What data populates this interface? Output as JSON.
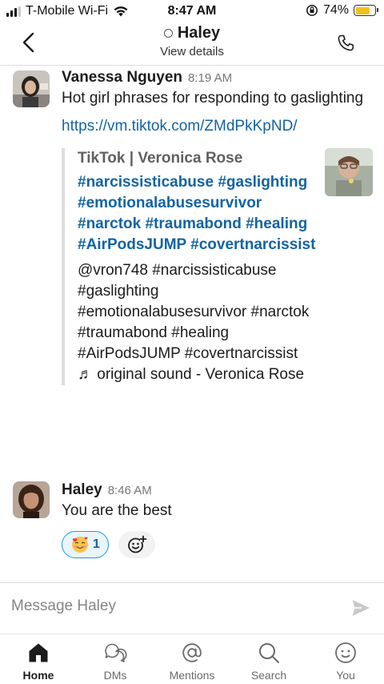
{
  "status_bar": {
    "carrier": "T-Mobile Wi-Fi",
    "time": "8:47 AM",
    "battery": "74%",
    "battery_level": 0.74,
    "battery_color": "#f3c21a"
  },
  "header": {
    "title": "Haley",
    "subtitle": "View details",
    "back_icon": "chevron-left-icon",
    "call_icon": "phone-icon"
  },
  "messages": [
    {
      "sender": "Vanessa Nguyen",
      "time": "8:19 AM",
      "text": "Hot girl phrases for responding to gaslighting",
      "link": "https://vm.tiktok.com/ZMdPkKpND/",
      "unfurl": {
        "source": "TikTok | Veronica Rose",
        "title": "#narcissisticabuse #gaslighting #emotionalabusesurvivor #narctok #traumabond #healing #AirPodsJUMP #covertnarcissist",
        "description": "@vron748 #narcissisticabuse #gaslighting #emotionalabusesurvivor #narctok #traumabond #healing #AirPodsJUMP #covertnarcissist ♬ original sound - Veronica Rose"
      }
    },
    {
      "sender": "Haley",
      "time": "8:46 AM",
      "text": "You are the best",
      "reactions": [
        {
          "emoji": "🥰",
          "count": "1",
          "icon": "smiling-face-with-hearts-icon"
        }
      ],
      "add_reaction_icon": "add-reaction-icon"
    }
  ],
  "composer": {
    "placeholder": "Message Haley",
    "send_icon": "send-icon"
  },
  "tabs": [
    {
      "label": "Home",
      "icon": "home-icon",
      "active": true
    },
    {
      "label": "DMs",
      "icon": "dms-icon",
      "active": false
    },
    {
      "label": "Mentions",
      "icon": "mentions-icon",
      "active": false
    },
    {
      "label": "Search",
      "icon": "search-icon",
      "active": false
    },
    {
      "label": "You",
      "icon": "you-icon",
      "active": false
    }
  ],
  "colors": {
    "link": "#1264a3",
    "reaction_border": "#1d9bd1",
    "reaction_bg": "#e8f5fa"
  }
}
